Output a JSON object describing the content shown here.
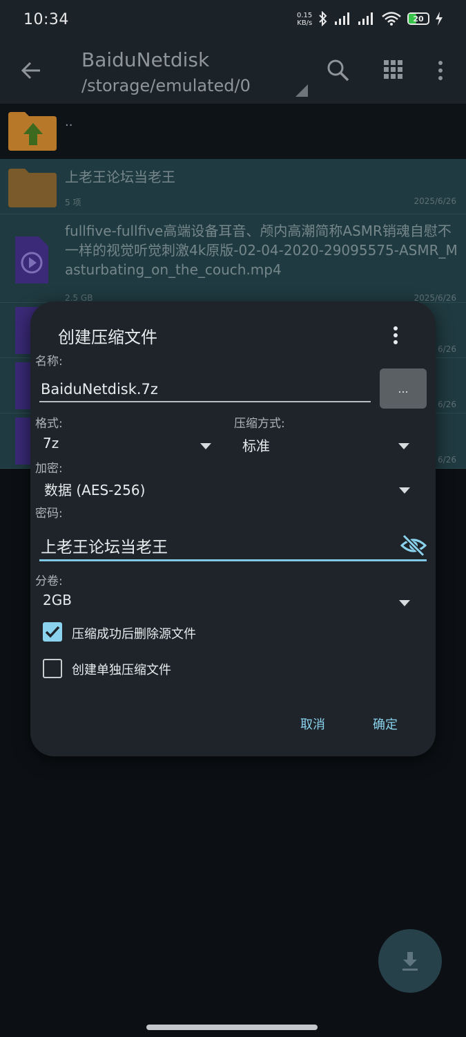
{
  "status_bar": {
    "time": "10:34",
    "net_speed_value": "0.15",
    "net_speed_unit": "KB/s",
    "battery": "20",
    "sim2_label": "5"
  },
  "app_bar": {
    "title": "BaiduNetdisk",
    "subtitle": "/storage/emulated/0"
  },
  "file_list": {
    "parent_label": "..",
    "items": [
      {
        "name": "上老王论坛当老王",
        "meta": "5 项",
        "date": "2025/6/26",
        "type": "folder"
      },
      {
        "name": "fullfive-fullfive高端设备耳音、颅内高潮简称ASMR销魂自慰不一样的视觉听觉刺激4k原版-02-04-2020-29095575-ASMR_Masturbating_on_the_couch.mp4",
        "meta": "2.5 GB",
        "date": "2025/6/26",
        "type": "video"
      },
      {
        "date": "6/26",
        "type": "video"
      },
      {
        "date": "6/26",
        "type": "video"
      },
      {
        "date": "6/26",
        "type": "video"
      }
    ]
  },
  "dialog": {
    "title": "创建压缩文件",
    "name_label": "名称:",
    "name_value": "BaiduNetdisk.7z",
    "browse_label": "...",
    "format_label": "格式:",
    "format_value": "7z",
    "method_label": "压缩方式:",
    "method_value": "标准",
    "encryption_label": "加密:",
    "encryption_value": "数据 (AES-256)",
    "password_label": "密码:",
    "password_value": "上老王论坛当老王",
    "split_label": "分卷:",
    "split_value": "2GB",
    "delete_source_label": "压缩成功后删除源文件",
    "delete_source_checked": true,
    "separate_archive_label": "创建单独压缩文件",
    "separate_archive_checked": false,
    "cancel_label": "取消",
    "ok_label": "确定"
  },
  "colors": {
    "accent": "#8ad2ee",
    "selected_row": "#1f3a40",
    "dialog_bg": "#1e2429",
    "folder": "#b8782a",
    "video": "#3a2a78"
  }
}
